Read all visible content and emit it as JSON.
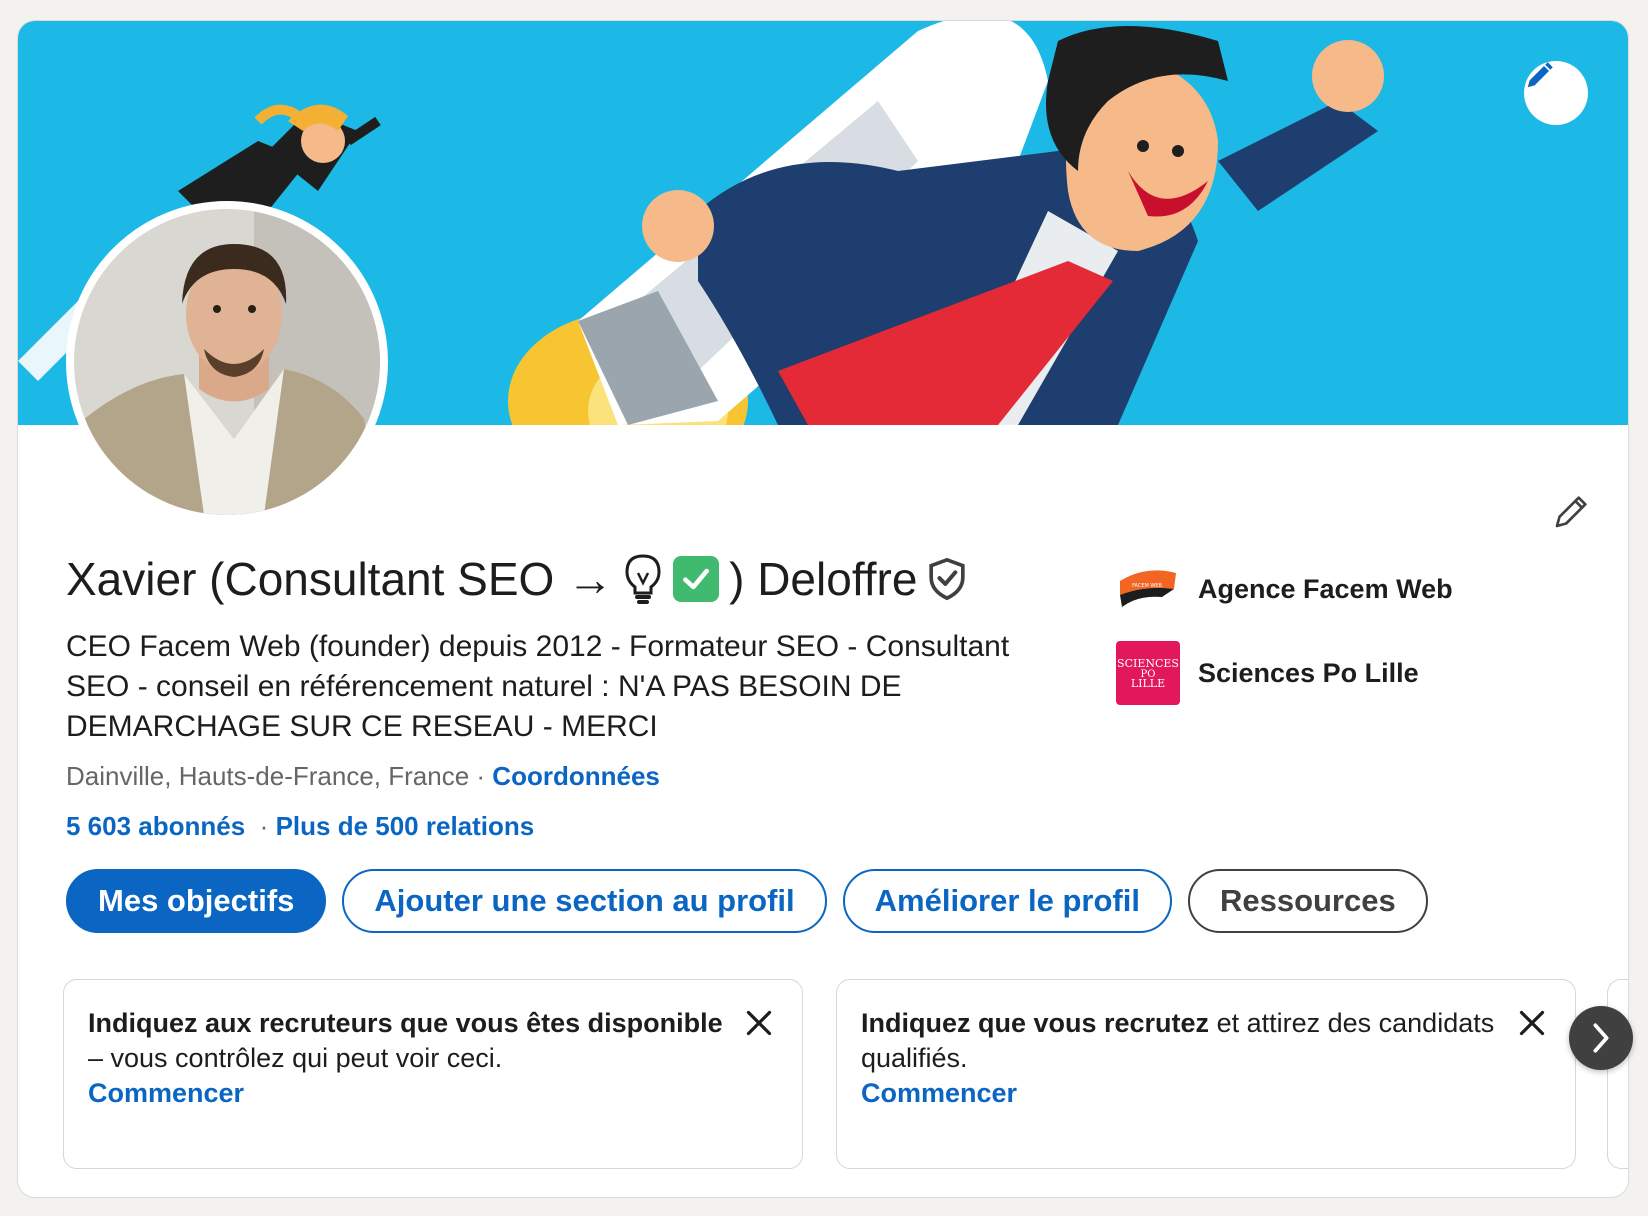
{
  "profile": {
    "name_part1": "Xavier (Consultant SEO →",
    "name_part2": ") Deloffre",
    "headline": "CEO Facem Web (founder) depuis 2012 - Formateur SEO - Consultant SEO - conseil en référencement naturel : N'A PAS BESOIN DE DEMARCHAGE SUR CE RESEAU - MERCI",
    "location": "Dainville, Hauts-de-France, France",
    "location_separator": "·",
    "contact_link": "Coordonnées",
    "followers": "5 603 abonnés",
    "stats_separator": "·",
    "connections": "Plus de 500 relations"
  },
  "companies": [
    {
      "label": "Agence Facem Web",
      "logo_text": "FACEM WEB",
      "icon": "facem-web-logo"
    },
    {
      "label": "Sciences Po Lille",
      "logo_text_1": "SCIENCES",
      "logo_text_2": "PO",
      "logo_text_3": "LILLE",
      "icon": "sciences-po-lille-logo"
    }
  ],
  "actions": {
    "goals": "Mes objectifs",
    "add_section": "Ajouter une section au profil",
    "improve": "Améliorer le profil",
    "resources": "Ressources"
  },
  "suggestions": [
    {
      "bold": "Indiquez aux recruteurs que vous êtes disponible",
      "rest": " – vous contrôlez qui peut voir ceci.",
      "link": "Commencer"
    },
    {
      "bold": "Indiquez que vous recrutez",
      "rest": " et attirez des candidats qualifiés.",
      "link": "Commencer"
    }
  ],
  "icons": {
    "banner_edit": "pencil-icon",
    "profile_edit": "pencil-icon",
    "verified": "shield-check-icon",
    "close": "close-icon",
    "next": "chevron-right-icon",
    "light_bulb": "light-bulb-emoji",
    "check": "check-mark-emoji"
  },
  "colors": {
    "accent": "#0a66c2",
    "banner": "#1cb9e6",
    "facem_orange": "#f26522",
    "sciences_po_pink": "#e3175b"
  }
}
